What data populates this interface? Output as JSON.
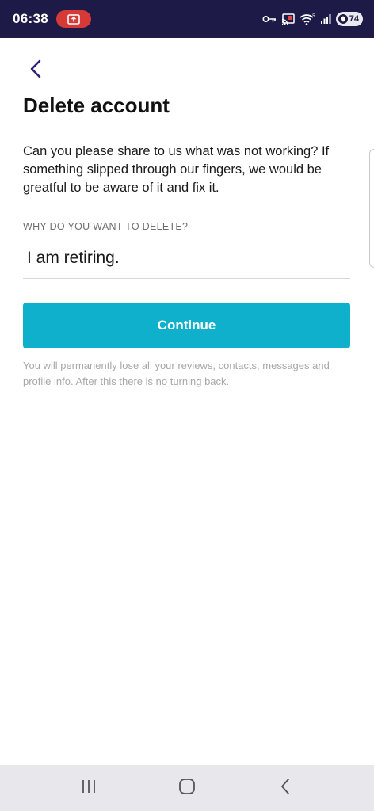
{
  "status_bar": {
    "time": "06:38",
    "battery_level": "74",
    "background_color": "#1e1a47"
  },
  "screen": {
    "back_icon": "chevron-left-icon",
    "title": "Delete account",
    "description": "Can you please share to us what was not working? If something slipped through our fingers, we would be greatful to be aware of it and fix it.",
    "reason_field": {
      "label": "WHY DO YOU WANT TO DELETE?",
      "value": "I am retiring."
    },
    "continue_button": {
      "label": "Continue",
      "color": "#0fb0cb"
    },
    "warning_text": "You will permanently lose all your reviews, contacts, messages and profile info. After this there is no turning back."
  },
  "nav_bar": {
    "recents_icon": "recents-icon",
    "home_icon": "home-icon",
    "back_icon": "back-icon"
  }
}
